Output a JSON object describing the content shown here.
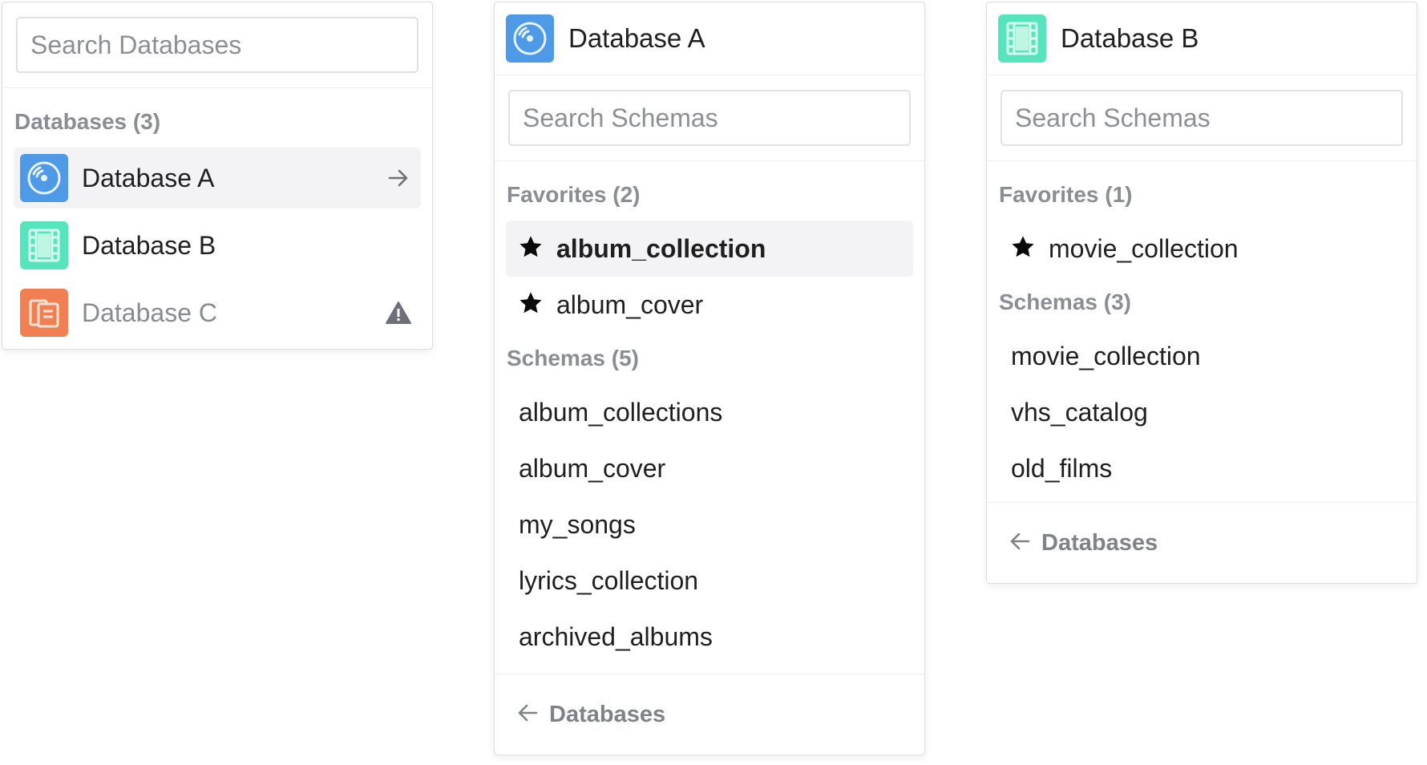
{
  "databases_panel": {
    "search_placeholder": "Search Databases",
    "section_label": "Databases (3)",
    "items": [
      {
        "label": "Database A",
        "icon": "vinyl-record-icon",
        "color": "#4f9ae6",
        "selected": true,
        "trailing_icon": "arrow-right-icon"
      },
      {
        "label": "Database B",
        "icon": "film-strip-icon",
        "color": "#55e4bc",
        "selected": false
      },
      {
        "label": "Database C",
        "icon": "books-icon",
        "color": "#f07f52",
        "selected": false,
        "trailing_icon": "warning-icon",
        "disabled": true
      }
    ]
  },
  "database_a_panel": {
    "title": "Database A",
    "icon": "vinyl-record-icon",
    "search_placeholder": "Search Schemas",
    "favorites_label": "Favorites (2)",
    "favorites": [
      {
        "label": "album_collection",
        "selected": true
      },
      {
        "label": "album_cover",
        "selected": false
      }
    ],
    "schemas_label": "Schemas (5)",
    "schemas": [
      "album_collections",
      "album_cover",
      "my_songs",
      "lyrics_collection",
      "archived_albums"
    ],
    "footer_label": "Databases"
  },
  "database_b_panel": {
    "title": "Database B",
    "icon": "film-strip-icon",
    "search_placeholder": "Search Schemas",
    "favorites_label": "Favorites (1)",
    "favorites": [
      {
        "label": "movie_collection",
        "selected": false
      }
    ],
    "schemas_label": "Schemas (3)",
    "schemas": [
      "movie_collection",
      "vhs_catalog",
      "old_films"
    ],
    "footer_label": "Databases"
  },
  "colors": {
    "accent_blue": "#4f9ae6",
    "accent_green": "#55e4bc",
    "accent_orange": "#f07f52",
    "selected_bg": "#f3f3f5",
    "muted_text": "#8a8d93"
  }
}
